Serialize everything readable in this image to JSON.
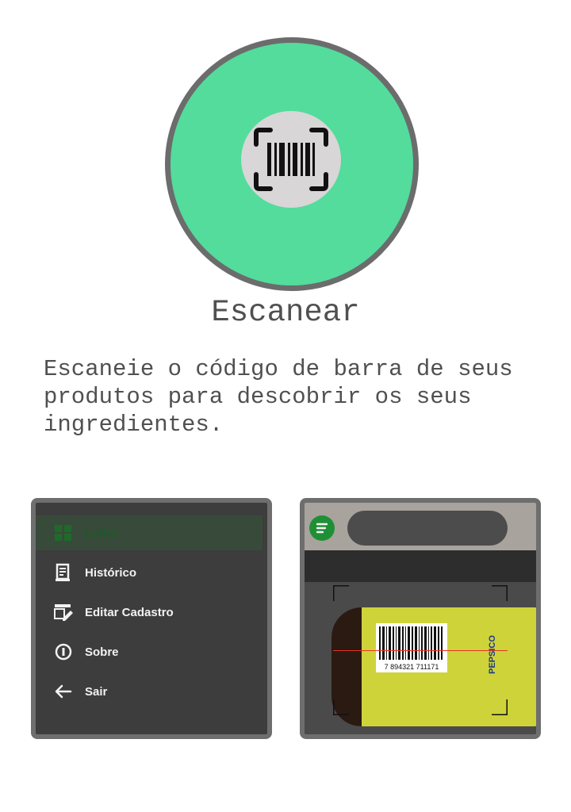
{
  "hero": {
    "icon": "barcode-scan-icon",
    "circle_color": "#53dc9c"
  },
  "title": "Escanear",
  "description_lines": [
    "Escaneie o código de barra de seus",
    "produtos para descobrir os seus",
    "ingredientes."
  ],
  "menu": {
    "items": [
      {
        "label": "Leitor",
        "icon": "grid-icon",
        "active": true
      },
      {
        "label": "Histórico",
        "icon": "receipt-icon"
      },
      {
        "label": "Editar Cadastro",
        "icon": "edit-document-icon"
      },
      {
        "label": "Sobre",
        "icon": "info-icon"
      },
      {
        "label": "Sair",
        "icon": "arrow-left-icon"
      }
    ]
  },
  "camera": {
    "barcode_digits": "7 894321 711171",
    "brand": "PEPSICO"
  }
}
